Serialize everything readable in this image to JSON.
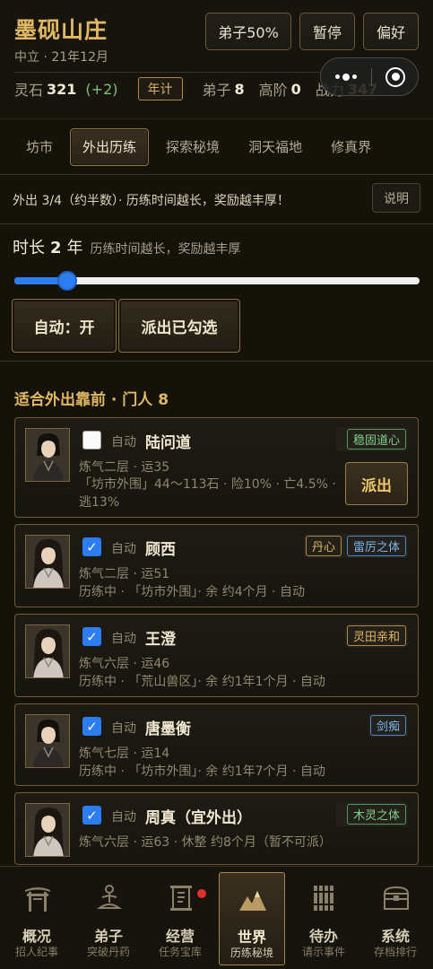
{
  "header": {
    "sect_name": "墨砚山庄",
    "subtitle": "中立 · 21年12月",
    "buttons": [
      "弟子50%",
      "暂停",
      "偏好"
    ],
    "stats": {
      "stone_label": "灵石",
      "stone_value": "321",
      "stone_delta": "(+2)",
      "year_button": "年计",
      "disciple_label": "弟子",
      "disciple_value": "8",
      "senior_label": "高阶",
      "senior_value": "0",
      "power_label": "战力",
      "power_value": "347"
    }
  },
  "tabs": [
    "坊市",
    "外出历练",
    "探索秘境",
    "洞天福地",
    "修真界"
  ],
  "active_tab": "外出历练",
  "info": {
    "text": "外出 3/4（约半数）· 历练时间越长，奖励越丰厚！",
    "help_button": "说明"
  },
  "duration": {
    "label": "时长",
    "value": "2",
    "unit": "年",
    "hint": "历练时间越长，奖励越丰厚",
    "slider_fraction": 0.13
  },
  "actions": {
    "auto_toggle": "自动：开",
    "dispatch_checked": "派出已勾选"
  },
  "list_title": "适合外出靠前 · 门人 8",
  "auto_label": "自动",
  "dispatch_label": "派出",
  "disciples": [
    {
      "name": "陆问道",
      "checked": false,
      "tags": [
        {
          "text": "稳固道心",
          "color": "green"
        }
      ],
      "line1": "炼气二层 · 运35",
      "line2": "「坊市外围」44～113石 · 险10% · 亡4.5% · 逃13%",
      "can_dispatch": true,
      "avatar": "male"
    },
    {
      "name": "顾西",
      "checked": true,
      "tags": [
        {
          "text": "丹心",
          "color": "gold"
        },
        {
          "text": "雷厉之体",
          "color": "blue"
        }
      ],
      "line1": "炼气二层 · 运51",
      "line2": "历练中 · 「坊市外围」· 余 约4个月 · 自动",
      "can_dispatch": false,
      "avatar": "female"
    },
    {
      "name": "王澄",
      "checked": true,
      "tags": [
        {
          "text": "灵田亲和",
          "color": "gold"
        }
      ],
      "line1": "炼气六层 · 运46",
      "line2": "历练中 · 「荒山兽区」· 余 约1年1个月 · 自动",
      "can_dispatch": false,
      "avatar": "female"
    },
    {
      "name": "唐墨衡",
      "checked": true,
      "tags": [
        {
          "text": "剑痴",
          "color": "blue"
        }
      ],
      "line1": "炼气七层 · 运14",
      "line2": "历练中 · 「坊市外围」· 余 约1年7个月 · 自动",
      "can_dispatch": false,
      "avatar": "male"
    },
    {
      "name": "周真（宜外出）",
      "checked": true,
      "tags": [
        {
          "text": "木灵之体",
          "color": "green"
        }
      ],
      "line1": "炼气六层 · 运63 · 休整 约8个月（暂不可派）",
      "line2": "",
      "can_dispatch": false,
      "avatar": "female"
    }
  ],
  "nav": [
    {
      "label": "概况",
      "sub": "招人纪事",
      "icon": "gate-icon"
    },
    {
      "label": "弟子",
      "sub": "突破丹药",
      "icon": "meditation-icon"
    },
    {
      "label": "经营",
      "sub": "任务宝库",
      "icon": "scroll-icon"
    },
    {
      "label": "世界",
      "sub": "历练秘境",
      "icon": "mountain-icon"
    },
    {
      "label": "待办",
      "sub": "请示事件",
      "icon": "bamboo-slips-icon"
    },
    {
      "label": "系统",
      "sub": "存档排行",
      "icon": "treasure-chest-icon"
    }
  ],
  "colors": {
    "accent_gold": "#e1b863",
    "slider_blue": "#2c7ef0",
    "notice_red": "#e0312f"
  }
}
